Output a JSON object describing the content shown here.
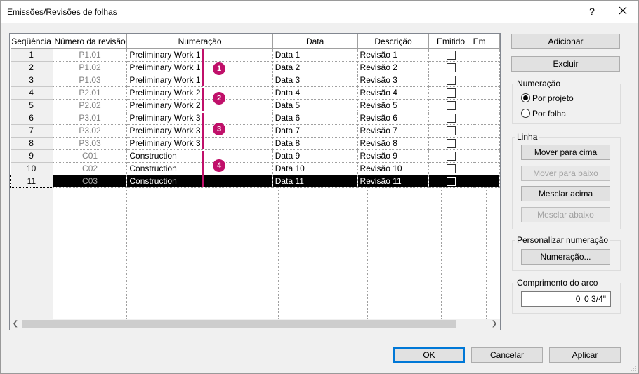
{
  "window": {
    "title": "Emissões/Revisões de folhas",
    "help": "?",
    "close_icon": "close-icon"
  },
  "table": {
    "columns": [
      "Seqüência",
      "Número da revisão",
      "Numeração",
      "Data",
      "Descrição",
      "Emitido",
      "Em"
    ],
    "rows": [
      {
        "seq": "1",
        "num": "P1.01",
        "numbering": "Preliminary Work 1",
        "date": "Data 1",
        "desc": "Revisão 1",
        "issued": false
      },
      {
        "seq": "2",
        "num": "P1.02",
        "numbering": "Preliminary Work 1",
        "date": "Data 2",
        "desc": "Revisão 2",
        "issued": false
      },
      {
        "seq": "3",
        "num": "P1.03",
        "numbering": "Preliminary Work 1",
        "date": "Data 3",
        "desc": "Revisão 3",
        "issued": false
      },
      {
        "seq": "4",
        "num": "P2.01",
        "numbering": "Preliminary Work 2",
        "date": "Data 4",
        "desc": "Revisão 4",
        "issued": false
      },
      {
        "seq": "5",
        "num": "P2.02",
        "numbering": "Preliminary Work 2",
        "date": "Data 5",
        "desc": "Revisão 5",
        "issued": false
      },
      {
        "seq": "6",
        "num": "P3.01",
        "numbering": "Preliminary Work 3",
        "date": "Data 6",
        "desc": "Revisão 6",
        "issued": false
      },
      {
        "seq": "7",
        "num": "P3.02",
        "numbering": "Preliminary Work 3",
        "date": "Data 7",
        "desc": "Revisão 7",
        "issued": false
      },
      {
        "seq": "8",
        "num": "P3.03",
        "numbering": "Preliminary Work 3",
        "date": "Data 8",
        "desc": "Revisão 8",
        "issued": false
      },
      {
        "seq": "9",
        "num": "C01",
        "numbering": "Construction",
        "date": "Data 9",
        "desc": "Revisão 9",
        "issued": false
      },
      {
        "seq": "10",
        "num": "C02",
        "numbering": "Construction",
        "date": "Data 10",
        "desc": "Revisão 10",
        "issued": false
      },
      {
        "seq": "11",
        "num": "C03",
        "numbering": "Construction",
        "date": "Data 11",
        "desc": "Revisão 11",
        "issued": false,
        "selected": true
      }
    ],
    "callouts": [
      "1",
      "2",
      "3",
      "4"
    ],
    "accent_color": "#c0106a"
  },
  "buttons": {
    "add": "Adicionar",
    "delete": "Excluir",
    "move_up": "Mover para cima",
    "move_down": "Mover para baixo",
    "merge_up": "Mesclar acima",
    "merge_down": "Mesclar abaixo",
    "numbering": "Numeração...",
    "ok": "OK",
    "cancel": "Cancelar",
    "apply": "Aplicar"
  },
  "numbering_group": {
    "label": "Numeração",
    "per_project": "Por projeto",
    "per_sheet": "Por folha",
    "selected": "per_project"
  },
  "line_group": {
    "label": "Linha"
  },
  "custom_numbering_group": {
    "label": "Personalizar numeração"
  },
  "arc_length_group": {
    "label": "Comprimento do arco",
    "value": "0'  0 3/4\""
  }
}
